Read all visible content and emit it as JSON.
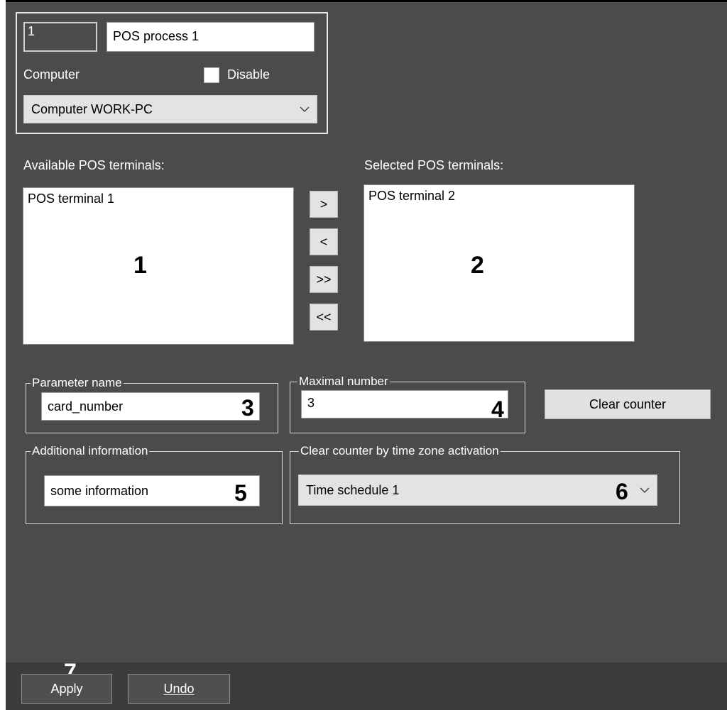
{
  "header": {
    "id_value": "1",
    "name_value": "POS process 1",
    "computer_label": "Computer",
    "disable_label": "Disable",
    "disable_checked": false,
    "computer_select": "Computer WORK-PC"
  },
  "terminals": {
    "available_label": "Available POS terminals:",
    "selected_label": "Selected POS terminals:",
    "available_items": [
      "POS terminal 1"
    ],
    "selected_items": [
      "POS terminal 2"
    ],
    "available_marker": "1",
    "selected_marker": "2",
    "move_buttons": [
      ">",
      "<",
      ">>",
      "<<"
    ]
  },
  "parameter": {
    "legend": "Parameter name",
    "value": "card_number",
    "marker": "3"
  },
  "maximal": {
    "legend": "Maximal number",
    "value": "3",
    "marker": "4"
  },
  "clear_counter_button": "Clear counter",
  "additional": {
    "legend": "Additional information",
    "value": "some information",
    "marker": "5"
  },
  "timezone": {
    "legend": "Clear counter by time zone activation",
    "value": "Time schedule 1",
    "marker": "6"
  },
  "footer": {
    "apply_label": "Apply",
    "undo_label": "Undo",
    "marker": "7"
  },
  "icons": {
    "dropdown": "chevron-down-icon",
    "checkbox": "checkbox-icon"
  }
}
